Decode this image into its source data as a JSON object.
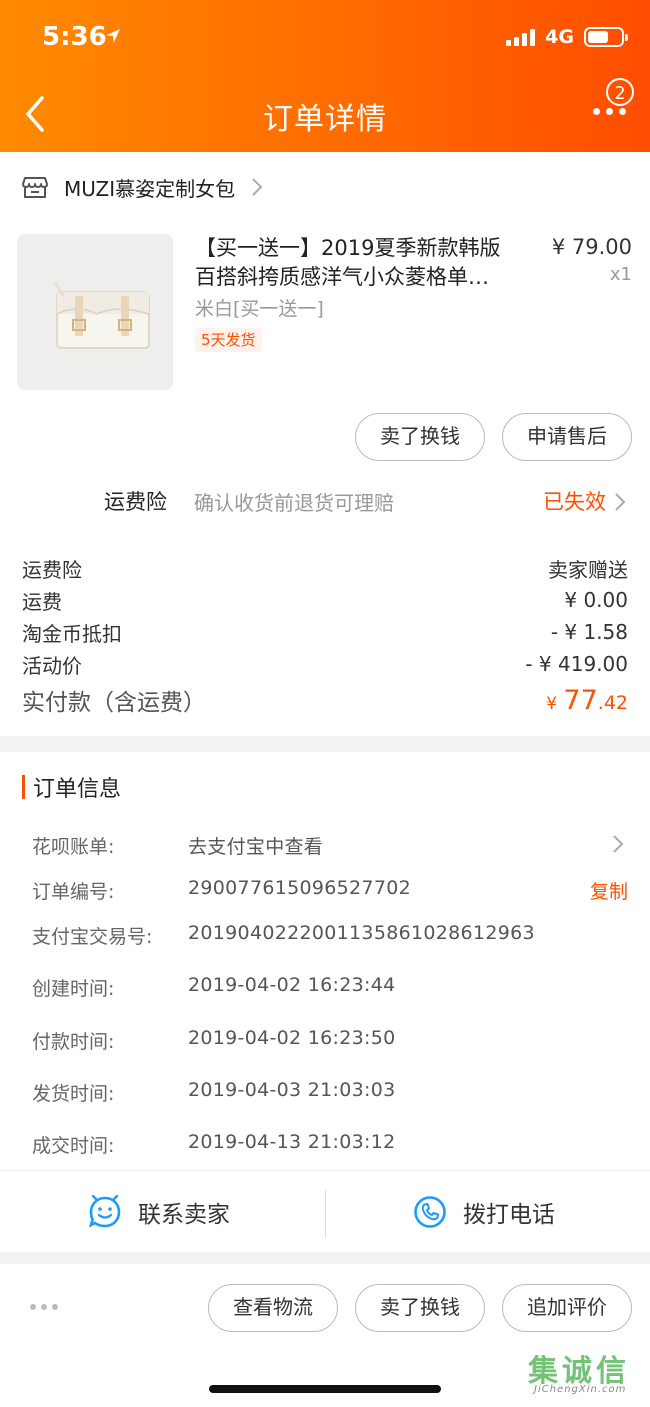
{
  "status": {
    "time": "5:36",
    "network": "4G"
  },
  "header": {
    "title": "订单详情",
    "badge": "2"
  },
  "shop": {
    "name": "MUZI慕姿定制女包"
  },
  "product": {
    "title_line1": "【买一送一】2019夏季新款韩版",
    "title_line2": "百搭斜挎质感洋气小众菱格单…",
    "price": "¥ 79.00",
    "qty": "x1",
    "spec": "米白[买一送一]",
    "tag": "5天发货",
    "buttons": [
      "卖了换钱",
      "申请售后"
    ]
  },
  "insurance": {
    "label": "运费险",
    "desc": "确认收货前退货可理赔",
    "status": "已失效"
  },
  "fees": [
    {
      "label": "运费险",
      "value": "卖家赠送"
    },
    {
      "label": "运费",
      "value": "¥ 0.00"
    },
    {
      "label": "淘金币抵扣",
      "value": "- ¥ 1.58"
    },
    {
      "label": "活动价",
      "value": "- ¥ 419.00"
    }
  ],
  "total": {
    "label": "实付款（含运费）",
    "currency": "¥",
    "integer": "77",
    "decimal": ".42"
  },
  "order_info": {
    "title": "订单信息",
    "rows": [
      {
        "label": "花呗账单:",
        "value": "去支付宝中查看"
      },
      {
        "label": "订单编号:",
        "value": "290077615096527702",
        "action": "复制"
      },
      {
        "label": "支付宝交易号:",
        "value": "2019040222001135861028612963"
      },
      {
        "label": "创建时间:",
        "value": "2019-04-02 16:23:44"
      },
      {
        "label": "付款时间:",
        "value": "2019-04-02 16:23:50"
      },
      {
        "label": "发货时间:",
        "value": "2019-04-03 21:03:03"
      },
      {
        "label": "成交时间:",
        "value": "2019-04-13 21:03:12"
      }
    ]
  },
  "contact": {
    "seller": "联系卖家",
    "phone": "拨打电话"
  },
  "bottom_actions": [
    "查看物流",
    "卖了换钱",
    "追加评价"
  ],
  "watermark": {
    "text": "集诚信",
    "sub": "JiChengXin.com"
  },
  "colors": {
    "accent": "#ff5000",
    "header_start": "#ff8a00",
    "header_end": "#ff4d00",
    "link_blue": "#1a9bfc"
  }
}
